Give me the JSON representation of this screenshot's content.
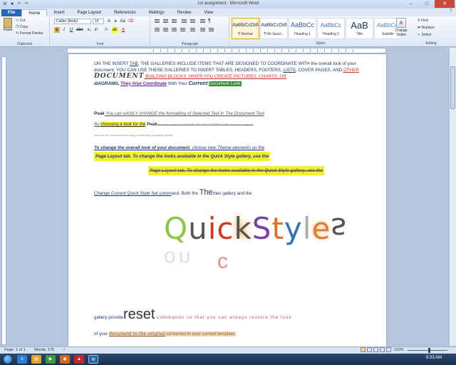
{
  "window": {
    "title": "1st assignment - Microsoft Word",
    "help": "?"
  },
  "tabs": [
    "File",
    "Home",
    "Insert",
    "Page Layout",
    "References",
    "Mailings",
    "Review",
    "View"
  ],
  "clipboard": {
    "paste": "Paste",
    "cut": "Cut",
    "copy": "Copy",
    "format_painter": "Format Painter",
    "label": "Clipboard"
  },
  "font": {
    "name": "Calibri (Body)",
    "size": "10",
    "label": "Font"
  },
  "paragraph": {
    "label": "Paragraph"
  },
  "styles": {
    "label": "Styles",
    "items": [
      {
        "sample": "AaBbCcDdI",
        "name": "¶ Normal"
      },
      {
        "sample": "AaBbCcDdI",
        "name": "¶ No Spaci..."
      },
      {
        "sample": "AaBbCc",
        "name": "Heading 1"
      },
      {
        "sample": "AaBbCc",
        "name": "Heading 2"
      },
      {
        "sample": "AaB",
        "name": "Title"
      },
      {
        "sample": "AaBbCcI",
        "name": "Subtitle"
      }
    ],
    "change": "Change Styles"
  },
  "editing": {
    "find": "Find",
    "replace": "Replace",
    "select": "Select",
    "label": "Editing"
  },
  "doc": {
    "p1a": "ON THE INSERT ",
    "p1_tab": "TAB",
    "p1b": ", THE GALLERIES INCLUDE ITEMS THAT ARE DESIGNED TO COORDINATE WITH the overall look of your document. YOU CAN USE THESE GALLERIES TO INSERT TABLES, HEADERS, FOOTERS, ",
    "p1_lists": "LISTS",
    "p1c": ", COVER PAGES, AND ",
    "p1_other": "OTHER",
    "p1_doc": "DOCUMENT",
    "p1d": " BUILDING BLOCKS. WHEN YOU CREATE PICTURES, CHARTS, OR",
    "p1e": "dIAGRAMS, ",
    "p1_they": "They Also Coordinate",
    "p1f": " With Your ",
    "p1_current": "Current",
    "p1_look": "Document Look.",
    "p2a": "Peak",
    "p2b": " You can eASILY cHANGE the formatting of Selected Text in The Document Text",
    "p2c": "By ",
    "p2_choosing": "choosing a look for the",
    "p2d": " Peak",
    "p2e": " the other controls on the HOME TAB. MOST CONTROLS offer a choice of using the",
    "p2f": "look from the current theme or using a format that you specify directly.",
    "p3a": "To change the overall look of your document",
    "p3b": ", choose new Theme elements on the",
    "p3c": "Page Layout tab. To change the looks available in the Quick Style gallery, use the",
    "p4a": "Change Current Quick Style Set comm",
    "p4b": "and. Both the ",
    "p4c": "The",
    "p4d": "mes gallery and the",
    "qs": [
      "Q",
      "u",
      "i",
      "c",
      "k",
      " ",
      "S",
      "t",
      "y",
      "l",
      "e",
      "s"
    ],
    "qs_refl": "on",
    "qs_refl_c": "c",
    "p5a": "gallery provide",
    "p5_reset": "reset",
    "p5b": " commands so that you can always restore the look",
    "p6a": "of your ",
    "p6_doc": "document to the original",
    "p6b": " contained in your current template."
  },
  "status": {
    "page": "Page: 1 of 1",
    "words": "Words: 175",
    "zoom": "110%"
  },
  "taskbar": {
    "time": "8:33 AM"
  }
}
